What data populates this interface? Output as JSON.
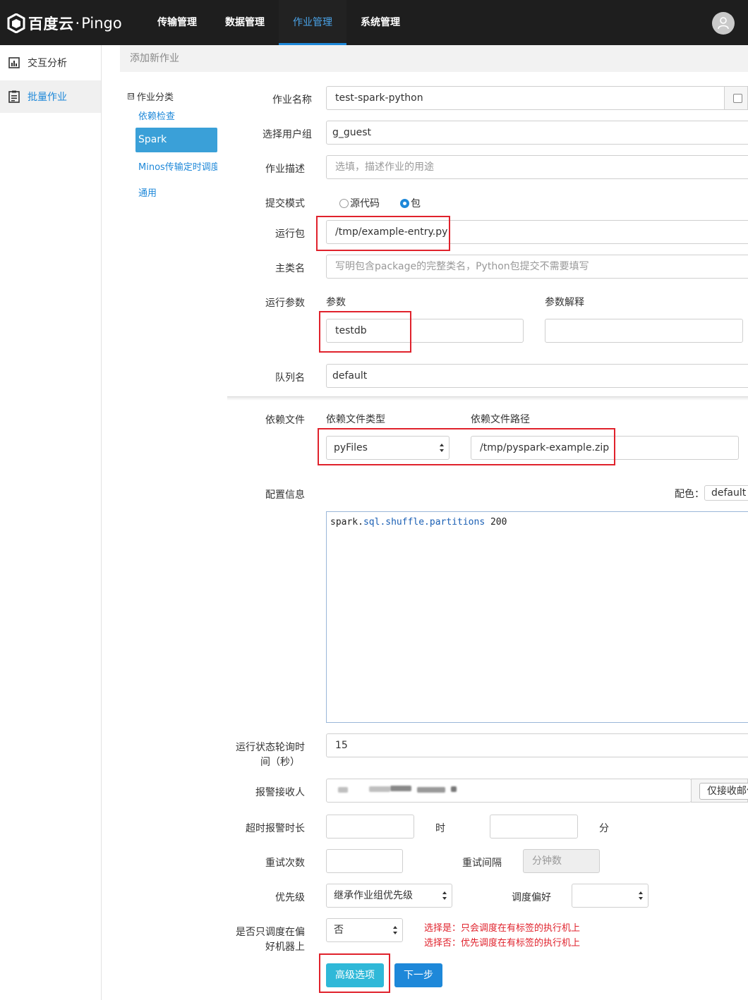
{
  "nav": {
    "logo_main": "百度云",
    "logo_sep": "·",
    "logo_sub": "Pingo",
    "items": [
      {
        "label": "传输管理"
      },
      {
        "label": "数据管理"
      },
      {
        "label": "作业管理",
        "active": true
      },
      {
        "label": "系统管理"
      }
    ]
  },
  "sidebar": {
    "items": [
      {
        "label": "交互分析",
        "icon": "chart-icon"
      },
      {
        "label": "批量作业",
        "icon": "document-icon",
        "active": true
      }
    ]
  },
  "breadcrumb": "添加新作业",
  "category_tree": {
    "root_toggle": "⊟",
    "root": "作业分类",
    "items": [
      {
        "label": "依赖检查"
      },
      {
        "label": "Spark",
        "active": true
      },
      {
        "label": "Minos传输定时调度"
      },
      {
        "label": "通用"
      }
    ]
  },
  "form": {
    "job_name": {
      "label": "作业名称",
      "value": "test-spark-python"
    },
    "user_group": {
      "label": "选择用户组",
      "value": "g_guest"
    },
    "job_desc": {
      "label": "作业描述",
      "placeholder": "选填，描述作业的用途"
    },
    "submit_mode": {
      "label": "提交模式",
      "options": [
        "源代码",
        "包"
      ],
      "selected": "包"
    },
    "run_package": {
      "label": "运行包",
      "value": "/tmp/example-entry.py"
    },
    "main_class": {
      "label": "主类名",
      "placeholder": "写明包含package的完整类名，Python包提交不需要填写"
    },
    "run_params": {
      "label": "运行参数",
      "col_param": "参数",
      "col_explain": "参数解释",
      "param_value": "testdb",
      "explain_value": ""
    },
    "queue": {
      "label": "队列名",
      "value": "default"
    },
    "dep_files": {
      "label": "依赖文件",
      "col_type": "依赖文件类型",
      "col_path": "依赖文件路径",
      "type_value": "pyFiles",
      "path_value": "/tmp/pyspark-example.zip"
    },
    "config": {
      "label": "配置信息",
      "color_label": "配色：",
      "color_value": "default",
      "code_kw": "spark.",
      "code_prop": "sql.shuffle.partitions",
      "code_val": " 200"
    },
    "poll_interval": {
      "label_line1": "运行状态轮询时",
      "label_line2": "间（秒）",
      "value": "15"
    },
    "alarm_receiver": {
      "label": "报警接收人",
      "mail_only": "仅接收邮件"
    },
    "timeout_alarm": {
      "label": "超时报警时长",
      "hour_unit": "时",
      "minute_unit": "分",
      "hour_value": "",
      "minute_value": ""
    },
    "retry": {
      "label": "重试次数",
      "value": "",
      "interval_label": "重试间隔",
      "interval_placeholder": "分钟数"
    },
    "priority": {
      "label": "优先级",
      "value": "继承作业组优先级",
      "sched_pref_label": "调度偏好",
      "sched_pref_value": ""
    },
    "only_preferred": {
      "label_line1": "是否只调度在偏",
      "label_line2": "好机器上",
      "value": "否",
      "hint_yes": "选择是：只会调度在有标签的执行机上",
      "hint_no": "选择否：优先调度在有标签的执行机上"
    }
  },
  "buttons": {
    "advanced": "高级选项",
    "next": "下一步"
  },
  "colors": {
    "topbar": "#1e1e1e",
    "accent": "#1e88d9",
    "highlight": "#e0222c",
    "advanced_btn": "#2fb8d8"
  }
}
